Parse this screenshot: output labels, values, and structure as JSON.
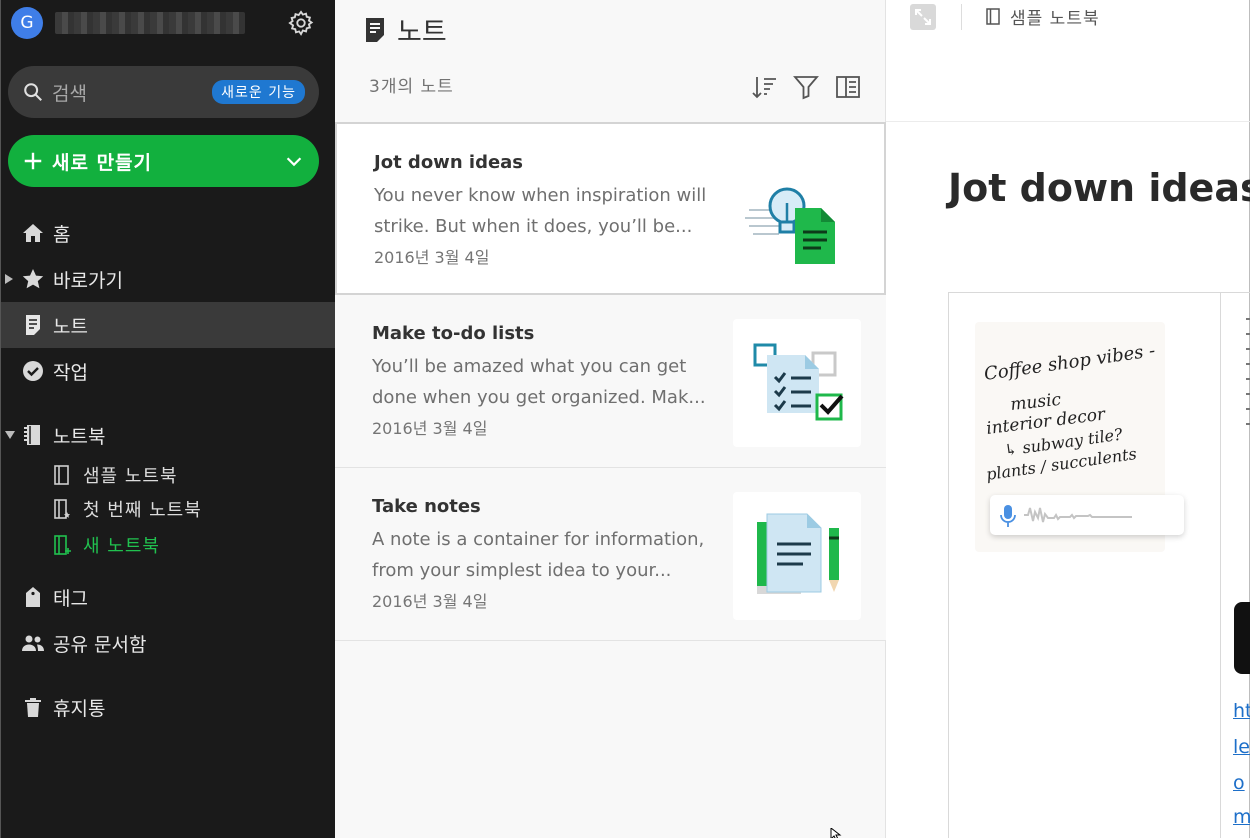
{
  "account": {
    "avatar_letter": "G"
  },
  "search": {
    "placeholder": "검색",
    "badge": "새로운 기능"
  },
  "create": {
    "label": "새로 만들기"
  },
  "nav": {
    "home": "홈",
    "shortcuts": "바로가기",
    "notes": "노트",
    "tasks": "작업",
    "notebooks": "노트북",
    "tags": "태그",
    "shared": "공유 문서함",
    "trash": "휴지통"
  },
  "notebooks": [
    {
      "label": "샘플 노트북"
    },
    {
      "label": "첫 번째 노트북"
    },
    {
      "label": "새 노트북"
    }
  ],
  "list": {
    "title": "노트",
    "count": "3개의 노트",
    "notes": [
      {
        "title": "Jot down ideas",
        "snippet": "You never know when inspiration will strike. But when it does, you’ll be...",
        "date": "2016년 3월 4일"
      },
      {
        "title": "Make to-do lists",
        "snippet": "You’ll be amazed what you can get done when you get organized. Mak...",
        "date": "2016년 3월 4일"
      },
      {
        "title": "Take notes",
        "snippet": "A note is a container for information, from your simplest idea to your...",
        "date": "2016년 3월 4일"
      }
    ]
  },
  "editor": {
    "breadcrumb": "샘플 노트북",
    "title": "Jot down ideas",
    "sketch_lines": [
      "Coffee shop vibes -",
      "music",
      "interior decor",
      "↳ subway tile?",
      "plants / succulents"
    ],
    "link_fragments": [
      "ht",
      "le",
      "o",
      "m"
    ]
  },
  "colors": {
    "accent_green": "#12b03e",
    "sidebar_bg": "#1a1a1a",
    "badge_blue": "#1f78d1"
  }
}
